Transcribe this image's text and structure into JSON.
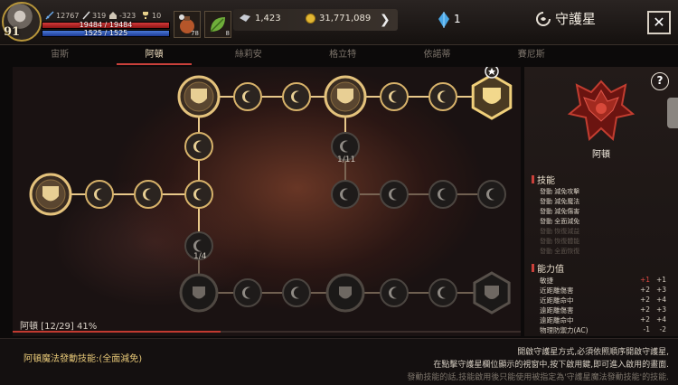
{
  "player": {
    "level": "91",
    "stat1": "12767",
    "stat2": "319",
    "stat3": "-323",
    "stat4": "10",
    "hp": "19484 / 19484",
    "mp": "1525 / 1525",
    "hp_fraction": 1,
    "mp_fraction": 1
  },
  "items": [
    {
      "count": "78",
      "icon": "potion-icon"
    },
    {
      "count": "8",
      "icon": "leaf-icon"
    }
  ],
  "currency": {
    "diamonds": "1,423",
    "gold": "31,771,089",
    "crystals": "1"
  },
  "window": {
    "title": "守護星",
    "close": "✕"
  },
  "tabs": [
    {
      "label": "宙斯",
      "active": false
    },
    {
      "label": "阿頓",
      "active": true
    },
    {
      "label": "絲莉安",
      "active": false
    },
    {
      "label": "格立特",
      "active": false
    },
    {
      "label": "依諾蒂",
      "active": false
    },
    {
      "label": "賽尼斯",
      "active": false
    }
  ],
  "tree": {
    "labels": [
      "1/11",
      "1/4"
    ]
  },
  "progress": {
    "text": "阿頓 [12/29] 41%",
    "fraction": 0.41
  },
  "side": {
    "name": "阿頓",
    "skills_header": "技能",
    "skills": [
      {
        "text": "發動 減免攻擊",
        "enabled": true
      },
      {
        "text": "發動 減免魔法",
        "enabled": true
      },
      {
        "text": "發動 減免傷害",
        "enabled": true
      },
      {
        "text": "發動 全面減免",
        "enabled": true
      },
      {
        "text": "發動 恢復減益",
        "enabled": false
      },
      {
        "text": "發動 恢復體能",
        "enabled": false
      },
      {
        "text": "發動 全面恢復",
        "enabled": false
      }
    ],
    "stats_header": "能力值",
    "stats": [
      {
        "name": "敏捷",
        "v1": "+1",
        "v2": "+1",
        "v1_red": true
      },
      {
        "name": "近距離傷害",
        "v1": "+2",
        "v2": "+3",
        "v1_red": false
      },
      {
        "name": "近距離命中",
        "v1": "+2",
        "v2": "+4",
        "v1_red": false
      },
      {
        "name": "遠距離傷害",
        "v1": "+2",
        "v2": "+3",
        "v1_red": false
      },
      {
        "name": "遠距離命中",
        "v1": "+2",
        "v2": "+4",
        "v1_red": false
      },
      {
        "name": "物理防禦力(AC)",
        "v1": "-1",
        "v2": "-2",
        "v1_red": false
      }
    ]
  },
  "bottom": {
    "skill_note": "阿頓魔法發動技能:(全面減免)",
    "hint1": "開啟守護星方式,必須依照順序開啟守護星,",
    "hint2": "在點擊守護星欄位顯示的視窗中,按下啟用鍵,即可進入啟用的畫面.",
    "hint3": "發動技能的話,技能啟用後只能使用被指定為'守護星魔法發動技能'的技能."
  },
  "colors": {
    "accent": "#c9403a",
    "gold": "#c9a24a"
  }
}
